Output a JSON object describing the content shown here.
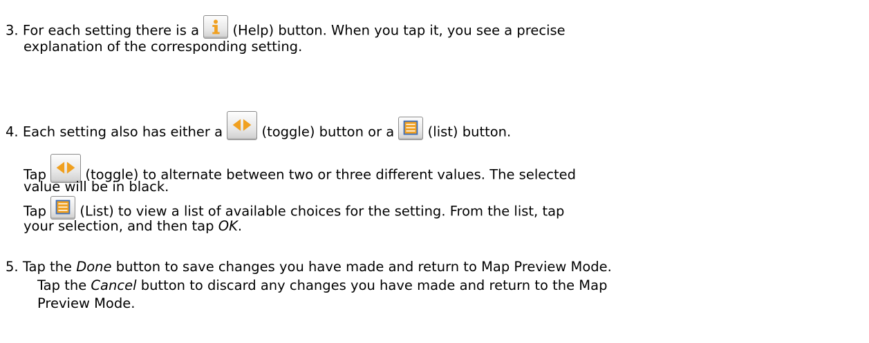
{
  "steps": {
    "s3": {
      "num": "3.",
      "pre": "For each setting there is a",
      "icon_label": "(Help)",
      "post": "button. When you tap it, you see a precise",
      "line2": "explanation of the corresponding setting.",
      "icon": "help-icon"
    },
    "s4": {
      "num": "4.",
      "pre": "Each setting also has either a",
      "mid": "(toggle) button or a",
      "post": "(list) button.",
      "toggle_icon": "toggle-icon",
      "list_icon": "list-icon",
      "toggle_line1_pre": "Tap",
      "toggle_line1_post": "(toggle) to alternate between two or three different values.  The selected",
      "toggle_line2": "value will be in black.",
      "list_line1_pre": "Tap",
      "list_line1_post": "(List) to view a list of available choices for the setting.  From the list, tap",
      "list_line2_pre": "your selection, and then tap",
      "list_line2_ok": "OK",
      "list_line2_post": "."
    },
    "s5": {
      "num": "5.",
      "line1_pre": "Tap the",
      "line1_done": "Done",
      "line1_post": "button to save changes you have made and return to Map Preview Mode.",
      "line2_pre": "Tap the",
      "line2_cancel": "Cancel",
      "line2_post": "button to discard any changes you have made and return to the Map",
      "line3": "Preview Mode."
    }
  },
  "colors": {
    "icon_orange": "#f0a020",
    "icon_blue": "#3f6fb8",
    "icon_border": "#8a8a8a"
  }
}
